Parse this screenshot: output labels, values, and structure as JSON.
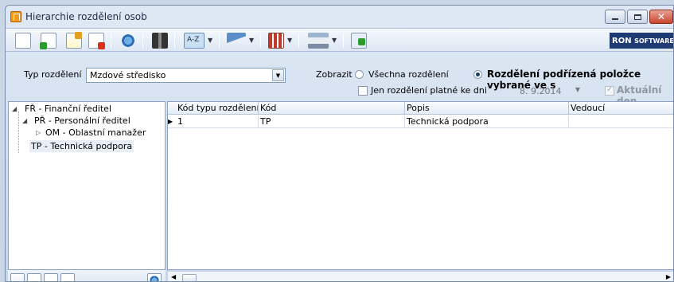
{
  "window": {
    "title": "Hierarchie rozdělení osob",
    "controls": [
      "minimize",
      "maximize",
      "close"
    ]
  },
  "toolbar": {
    "buttons": [
      "new-icon",
      "add-icon",
      "edit-icon",
      "delete-icon",
      "refresh-icon",
      "find-icon",
      "sort-icon",
      "filter-icon",
      "columns-icon",
      "print-icon",
      "export-icon"
    ],
    "logo_part1": "RON",
    "logo_part2": "SOFTWARE"
  },
  "filters": {
    "type_label": "Typ rozdělení",
    "type_value": "Mzdové středisko",
    "show_label": "Zobrazit :",
    "radio_all": "Všechna rozdělení",
    "radio_sub": "Rozdělení podřízená položce vybrané ve s",
    "check_valid": "Jen rozdělení platné ke dni",
    "date_value": "8. 9.2014",
    "check_current": "Aktuální den"
  },
  "tree": {
    "items": [
      {
        "label": "FŘ - Finanční ředitel"
      },
      {
        "label": "PŘ - Personální ředitel"
      },
      {
        "label": "OM - Oblastní manažer"
      },
      {
        "label": "TP - Technická podpora"
      }
    ]
  },
  "grid": {
    "columns": [
      "Kód typu rozdělení",
      "Kód",
      "Popis",
      "Vedoucí"
    ],
    "rows": [
      [
        "1",
        "TP",
        "Technická podpora",
        ""
      ]
    ]
  }
}
